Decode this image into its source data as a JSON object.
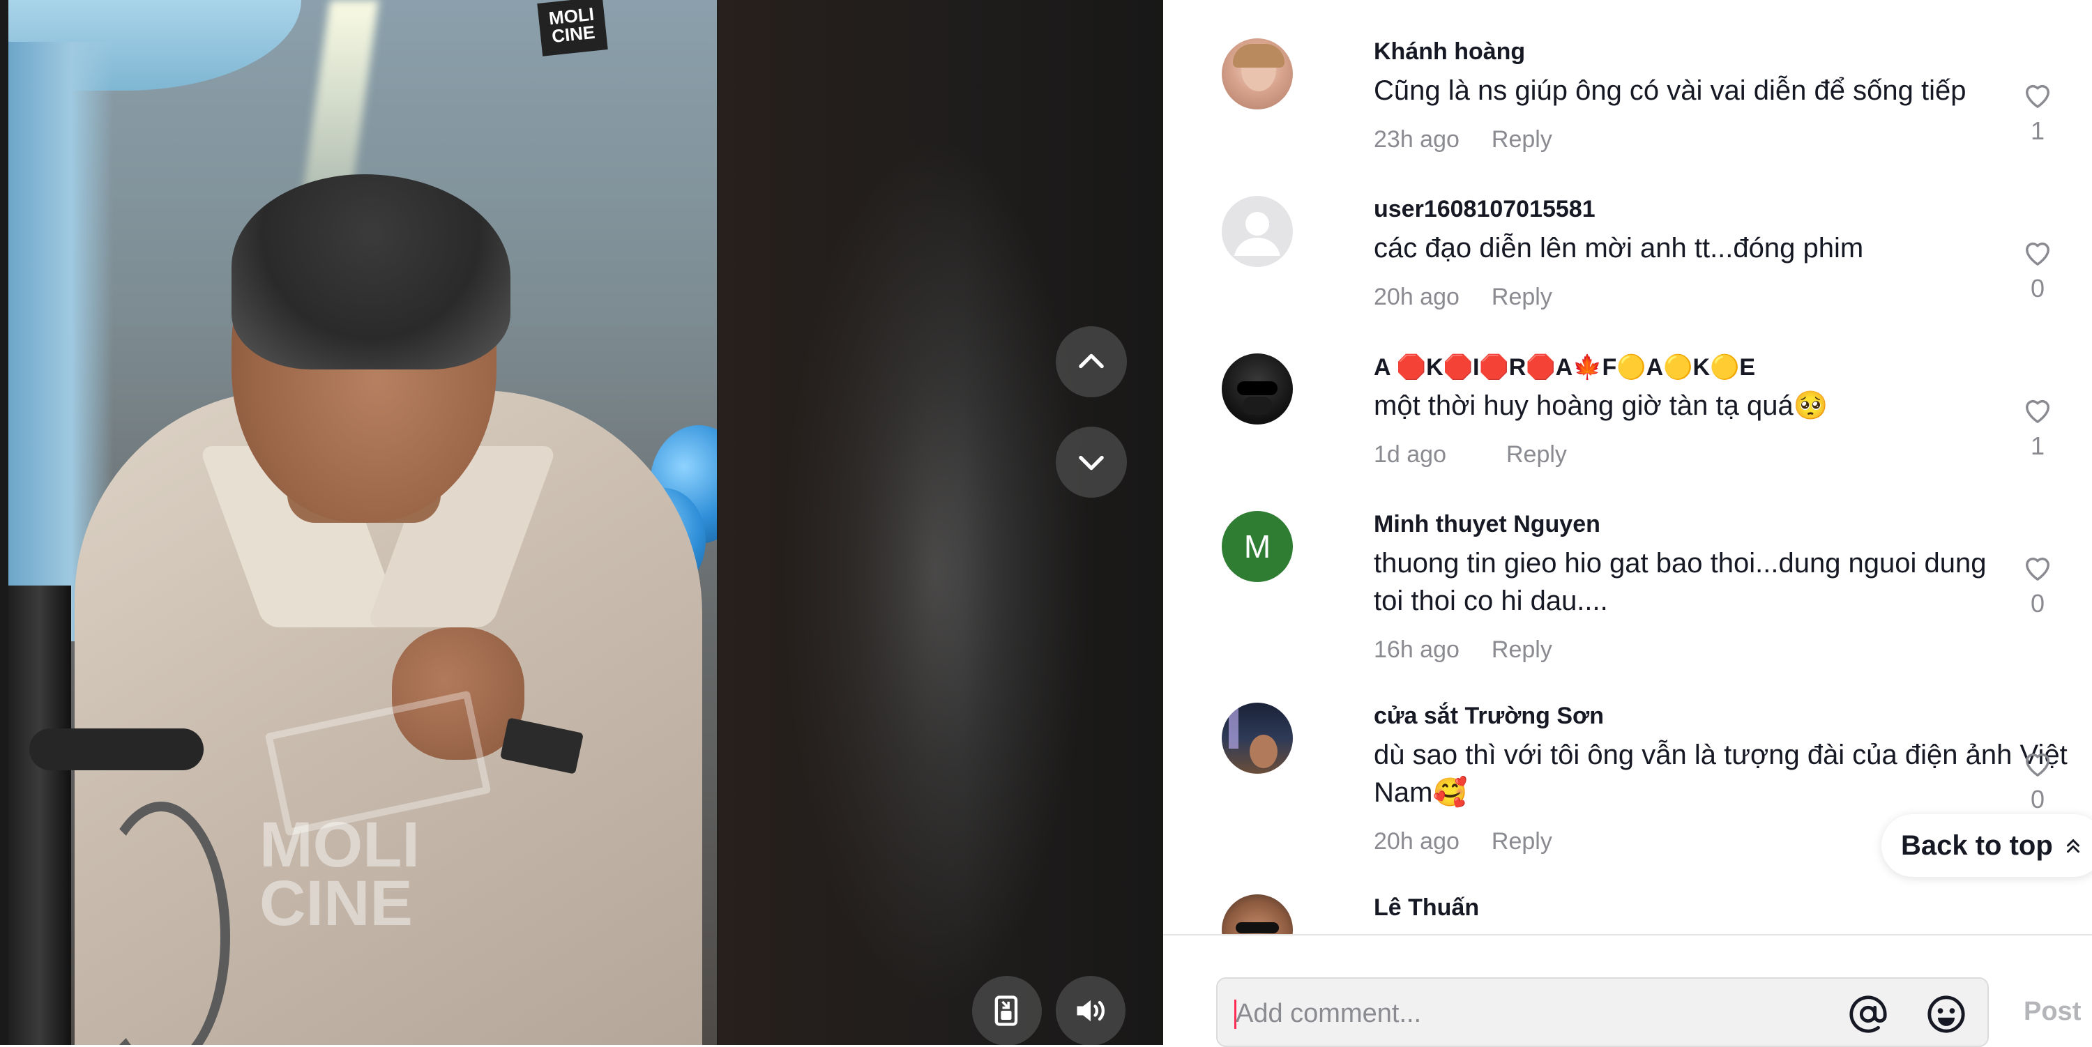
{
  "video": {
    "watermark_top": "MOLI CINE",
    "watermark_line1": "MOLI",
    "watermark_line2": "CINE",
    "controls": {
      "prev_icon": "chevron-up-icon",
      "next_icon": "chevron-down-icon",
      "miniplayer_icon": "miniplayer-icon",
      "volume_icon": "volume-icon"
    }
  },
  "comments": [
    {
      "user": "Khánh hoàng",
      "text": "Cũng là ns giúp ông có vài vai diễn để sống tiếp",
      "time": "23h ago",
      "reply": "Reply",
      "likes": "1",
      "avatar": "photo"
    },
    {
      "user": "user1608107015581",
      "text": "các đạo diễn lên mời anh tt...đóng phim",
      "time": "20h ago",
      "reply": "Reply",
      "likes": "0",
      "avatar": "default"
    },
    {
      "user": "A 🛑K🛑I🛑R🛑A🍁F🟡A🟡K🟡E",
      "text": "một thời huy hoàng giờ tàn tạ quá🥺",
      "time": "1d ago",
      "reply": "Reply",
      "likes": "1",
      "avatar": "photo-dark"
    },
    {
      "user": "Minh thuyet Nguyen",
      "text": "thuong tin gieo hio gat bao thoi...dung nguoi dung toi thoi co hi dau....",
      "time": "16h ago",
      "reply": "Reply",
      "likes": "0",
      "avatar": "letter",
      "avatar_letter": "M"
    },
    {
      "user": "cửa sắt Trường Sơn",
      "text": "dù sao thì với tôi ông vẫn là tượng đài của điện ảnh Việt Nam🥰",
      "time": "20h ago",
      "reply": "Reply",
      "likes": "0",
      "avatar": "photo-night"
    },
    {
      "user": "Lê Thuấn",
      "avatar": "photo-man"
    }
  ],
  "back_to_top": "Back to top",
  "input": {
    "placeholder": "Add comment...",
    "mention_icon": "at-icon",
    "emoji_icon": "emoji-icon",
    "post_label": "Post"
  },
  "colors": {
    "accent": "#fe2c55",
    "text_primary": "#161823",
    "text_secondary": "#8a8b91",
    "avatar_letter_bg": "#2e7d32"
  }
}
